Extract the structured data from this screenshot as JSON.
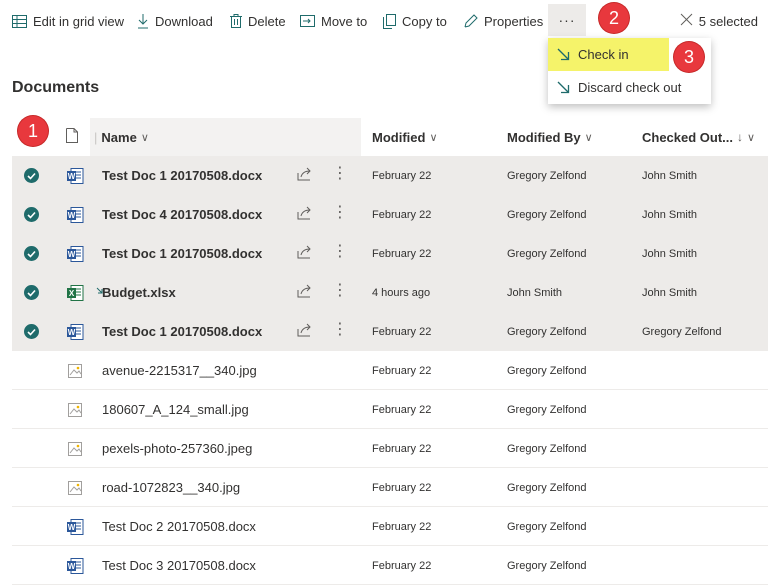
{
  "toolbar": {
    "edit_grid": "Edit in grid view",
    "download": "Download",
    "delete": "Delete",
    "move_to": "Move to",
    "copy_to": "Copy to",
    "properties": "Properties",
    "more": "···",
    "selected": "5 selected"
  },
  "menu": {
    "check_in": "Check in",
    "discard_checkout": "Discard check out"
  },
  "callouts": {
    "one": "1",
    "two": "2",
    "three": "3"
  },
  "page_title": "Documents",
  "columns": {
    "name": "Name",
    "modified": "Modified",
    "modified_by": "Modified By",
    "checked_out": "Checked Out..."
  },
  "rows": [
    {
      "name": "Test Doc 1 20170508.docx",
      "type": "word",
      "modified": "February 22",
      "modified_by": "Gregory Zelfond",
      "checked_out": "John Smith",
      "selected": true
    },
    {
      "name": "Test Doc 4 20170508.docx",
      "type": "word",
      "modified": "February 22",
      "modified_by": "Gregory Zelfond",
      "checked_out": "John Smith",
      "selected": true
    },
    {
      "name": "Test Doc 1 20170508.docx",
      "type": "word",
      "modified": "February 22",
      "modified_by": "Gregory Zelfond",
      "checked_out": "John Smith",
      "selected": true
    },
    {
      "name": "Budget.xlsx",
      "type": "excel",
      "modified": "4 hours ago",
      "modified_by": "John Smith",
      "checked_out": "John Smith",
      "selected": true
    },
    {
      "name": "Test Doc 1 20170508.docx",
      "type": "word",
      "modified": "February 22",
      "modified_by": "Gregory Zelfond",
      "checked_out": "Gregory Zelfond",
      "selected": true
    },
    {
      "name": "avenue-2215317__340.jpg",
      "type": "image",
      "modified": "February 22",
      "modified_by": "Gregory Zelfond",
      "checked_out": "",
      "selected": false
    },
    {
      "name": "180607_A_124_small.jpg",
      "type": "image",
      "modified": "February 22",
      "modified_by": "Gregory Zelfond",
      "checked_out": "",
      "selected": false
    },
    {
      "name": "pexels-photo-257360.jpeg",
      "type": "image",
      "modified": "February 22",
      "modified_by": "Gregory Zelfond",
      "checked_out": "",
      "selected": false
    },
    {
      "name": "road-1072823__340.jpg",
      "type": "image",
      "modified": "February 22",
      "modified_by": "Gregory Zelfond",
      "checked_out": "",
      "selected": false
    },
    {
      "name": "Test Doc 2 20170508.docx",
      "type": "word",
      "modified": "February 22",
      "modified_by": "Gregory Zelfond",
      "checked_out": "",
      "selected": false
    },
    {
      "name": "Test Doc 3 20170508.docx",
      "type": "word",
      "modified": "February 22",
      "modified_by": "Gregory Zelfond",
      "checked_out": "",
      "selected": false
    }
  ],
  "colors": {
    "check_green": "#1f6b6b",
    "badge_red": "#e8383d",
    "highlight_yellow": "#f5f36a",
    "word_blue": "#2b579a",
    "excel_green": "#217346",
    "icon_teal": "#1f6b6b"
  }
}
